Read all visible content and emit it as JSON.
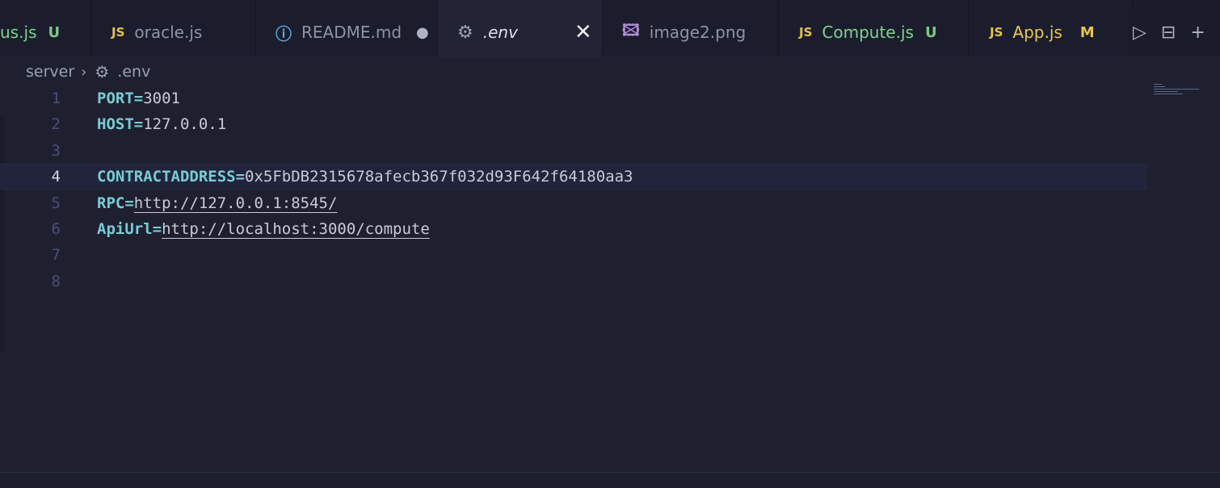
{
  "tabs": [
    {
      "name": "us.js",
      "badge": "U"
    },
    {
      "icon_label": "JS",
      "name": "oracle.js"
    },
    {
      "icon": "info-icon",
      "name": "README.md",
      "modified_dot": "●"
    },
    {
      "icon": "gear-icon",
      "name": ".env",
      "close": "✕"
    },
    {
      "icon": "image-icon",
      "name": "image2.png"
    },
    {
      "icon_label": "JS",
      "name": "Compute.js",
      "badge": "U"
    },
    {
      "icon_label": "JS",
      "name": "App.js",
      "badge": "M"
    }
  ],
  "breadcrumb": {
    "folder": "server",
    "file": ".env"
  },
  "editor": {
    "lines": [
      {
        "num": "1",
        "key": "PORT=",
        "value": "3001"
      },
      {
        "num": "2",
        "key": "HOST=",
        "value": "127.0.0.1"
      },
      {
        "num": "3",
        "key": "",
        "value": ""
      },
      {
        "num": "4",
        "key": "CONTRACTADDRESS=",
        "value": "0x5FbDB2315678afecb367f032d93F642f64180aa3"
      },
      {
        "num": "5",
        "key": "RPC=",
        "value": "http://127.0.0.1:8545/"
      },
      {
        "num": "6",
        "key": "ApiUrl=",
        "value": "http://localhost:3000/compute"
      },
      {
        "num": "7",
        "key": "",
        "value": ""
      },
      {
        "num": "8",
        "key": "",
        "value": ""
      }
    ],
    "current_line": "4"
  },
  "colors": {
    "key": "#78ccd4",
    "value": "#c8cbd6",
    "background": "#1e2030",
    "js_icon": "#e5c34c",
    "untracked_badge": "#7dc784",
    "modified_badge": "#e5c34c"
  }
}
